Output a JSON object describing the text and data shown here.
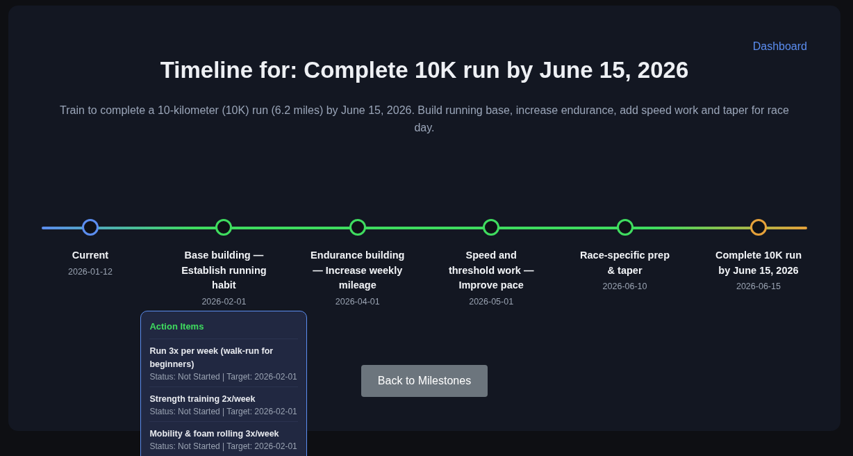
{
  "nav_link": "Dashboard",
  "title": "Timeline for: Complete 10K run by June 15, 2026",
  "description": "Train to complete a 10-kilometer (10K) run (6.2 miles) by June 15, 2026. Build running base, increase endurance, add speed work and taper for race day.",
  "milestones": [
    {
      "label": "Current",
      "date": "2026-01-12",
      "color": "#5b8def"
    },
    {
      "label": "Base building — Establish running habit",
      "date": "2026-02-01",
      "color": "#3fdc5f",
      "popup": {
        "title": "Action Items",
        "items": [
          {
            "name": "Run 3x per week (walk-run for beginners)",
            "meta": "Status: Not Started | Target: 2026-02-01"
          },
          {
            "name": "Strength training 2x/week",
            "meta": "Status: Not Started | Target: 2026-02-01"
          },
          {
            "name": "Mobility & foam rolling 3x/week",
            "meta": "Status: Not Started | Target: 2026-02-01"
          }
        ]
      }
    },
    {
      "label": "Endurance building — Increase weekly mileage",
      "date": "2026-04-01",
      "color": "#3fdc5f"
    },
    {
      "label": "Speed and threshold work — Improve pace",
      "date": "2026-05-01",
      "color": "#3fdc5f"
    },
    {
      "label": "Race-specific prep & taper",
      "date": "2026-06-10",
      "color": "#3fdc5f"
    },
    {
      "label": "Complete 10K run by June 15, 2026",
      "date": "2026-06-15",
      "color": "#e5a13a"
    }
  ],
  "button": "Back to Milestones"
}
